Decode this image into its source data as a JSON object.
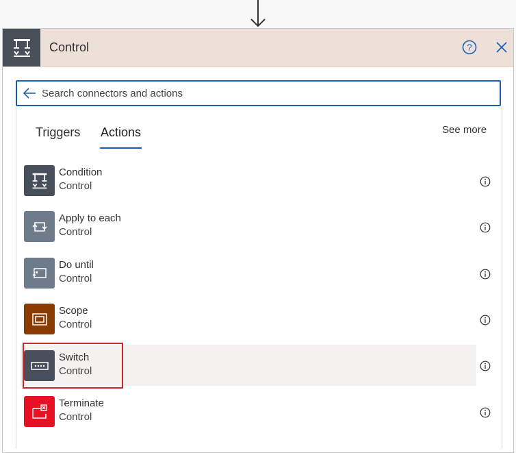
{
  "header": {
    "title": "Control",
    "icon": "control-icon",
    "help_icon": "help-icon",
    "close_icon": "close-icon",
    "color": "#ede0d8"
  },
  "search": {
    "placeholder": "Search connectors and actions",
    "value": "",
    "back_icon": "back-arrow-icon"
  },
  "tabs": [
    {
      "label": "Triggers",
      "selected": false
    },
    {
      "label": "Actions",
      "selected": true
    }
  ],
  "see_more": "See more",
  "actions": [
    {
      "title": "Condition",
      "subtitle": "Control",
      "icon": "condition-icon",
      "color": "#474f5a"
    },
    {
      "title": "Apply to each",
      "subtitle": "Control",
      "icon": "loop-icon",
      "color": "#6e7b8b"
    },
    {
      "title": "Do until",
      "subtitle": "Control",
      "icon": "do-until-icon",
      "color": "#6e7b8b"
    },
    {
      "title": "Scope",
      "subtitle": "Control",
      "icon": "scope-icon",
      "color": "#8a3c00"
    },
    {
      "title": "Switch",
      "subtitle": "Control",
      "icon": "switch-icon",
      "color": "#474f5a",
      "highlighted": true
    },
    {
      "title": "Terminate",
      "subtitle": "Control",
      "icon": "terminate-icon",
      "color": "#e81123"
    }
  ],
  "accent_color": "#1a5fb4",
  "highlight_color": "#d0232b"
}
